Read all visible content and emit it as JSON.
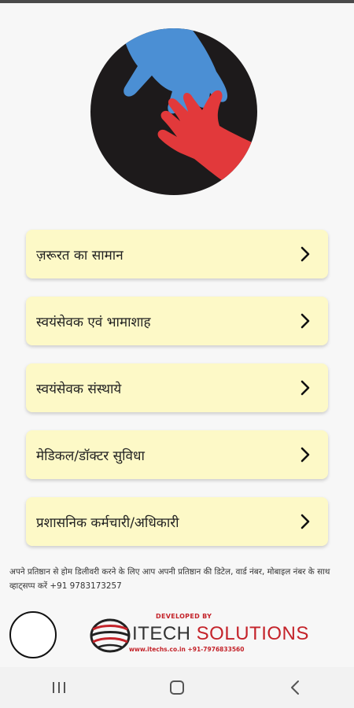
{
  "menu": {
    "items": [
      {
        "label": "ज़रूरत का सामान"
      },
      {
        "label": "स्वयंसेवक एवं भामाशाह"
      },
      {
        "label": "स्वयंसेवक संस्थाये"
      },
      {
        "label": "मेडिकल/डॉक्टर सुविधा"
      },
      {
        "label": "प्रशासनिक कर्मचारी/अधिकारी"
      }
    ]
  },
  "info": {
    "text": "अपने प्रतिष्ठान से होम डिलीवरी करने के लिए आप अपनी प्रतिष्ठान की डिटेल, वार्ड नंबर, मोबाइल नंबर के साथ व्हाट्सप्प करें +91 9783173257"
  },
  "developer": {
    "developed_by": "DEVELOPED BY",
    "name_part1": "ITECH",
    "name_part2": "SOLUTIONS",
    "contact": "www.itechs.co.in  +91-7976833560"
  },
  "colors": {
    "menu_bg": "#fdf9c7",
    "logo_bg": "#1d1a1b",
    "blue_hand": "#4b8fd4",
    "red_hand": "#e2393b",
    "brand_red": "#c4232a"
  },
  "icons": {
    "menu_arrow": "chevron-right-icon",
    "nav_recent": "recent-apps-icon",
    "nav_home": "home-icon",
    "nav_back": "back-icon"
  }
}
